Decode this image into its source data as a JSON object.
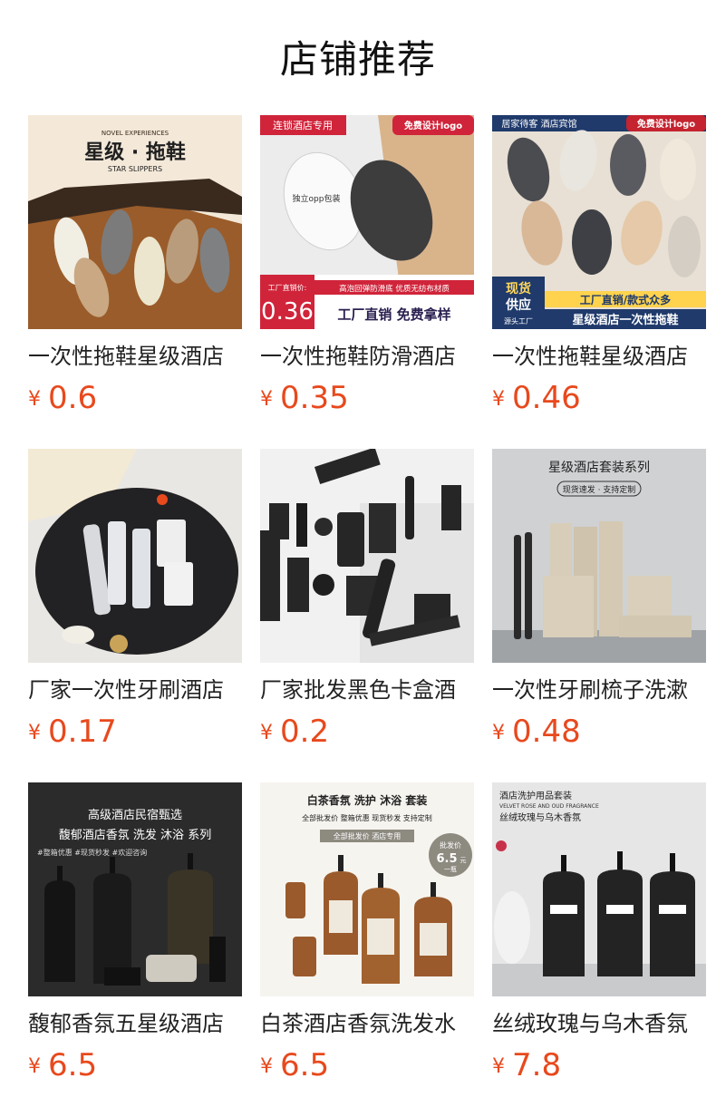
{
  "page": {
    "title": "店铺推荐"
  },
  "currency_symbol": "¥",
  "colors": {
    "price": "#e8491d",
    "badge_red": "#e0283a",
    "text": "#222222"
  },
  "products": [
    {
      "name": "一次性拖鞋星级酒店",
      "price": "0.6",
      "image": {
        "icon": "slippers-image",
        "texts": [
          "NOVEL EXPERIENCES",
          "星级 · 拖鞋",
          "STAR SLIPPERS"
        ]
      }
    },
    {
      "name": "一次性拖鞋防滑酒店",
      "price": "0.35",
      "image": {
        "icon": "slippers-image",
        "texts": [
          "连锁酒店专用",
          "免费设计logo",
          "独立opp包装",
          "工厂直销价:",
          "0.36",
          "高泡回弹防滑底 优质无纺布材质",
          "工厂直销 免费拿样"
        ]
      }
    },
    {
      "name": "一次性拖鞋星级酒店",
      "price": "0.46",
      "image": {
        "icon": "slippers-image",
        "texts": [
          "居家待客 酒店宾馆",
          "免费设计logo",
          "现货",
          "供应",
          "源头工厂",
          "工厂直销/款式众多",
          "星级酒店一次性拖鞋"
        ]
      }
    },
    {
      "name": "厂家一次性牙刷酒店",
      "price": "0.17",
      "image": {
        "icon": "toiletry-kit-image",
        "texts": []
      }
    },
    {
      "name": "厂家批发黑色卡盒酒",
      "price": "0.2",
      "image": {
        "icon": "toiletry-kit-image",
        "texts": []
      }
    },
    {
      "name": "一次性牙刷梳子洗漱",
      "price": "0.48",
      "image": {
        "icon": "toothbrush-box-image",
        "texts": [
          "星级酒店套装系列",
          "现货速发 · 支持定制"
        ]
      }
    },
    {
      "name": "馥郁香氛五星级酒店",
      "price": "6.5",
      "image": {
        "icon": "shampoo-bottles-image",
        "texts": [
          "高级酒店民宿甄选",
          "馥郁酒店香氛 洗发 沐浴 系列",
          "#整箱优惠 #现货秒发 #欢迎咨询"
        ]
      }
    },
    {
      "name": "白茶酒店香氛洗发水",
      "price": "6.5",
      "image": {
        "icon": "shampoo-bottles-image",
        "texts": [
          "白茶香氛 洗护 沐浴 套装",
          "全部批发价 整箱优惠 现货秒发 支持定制",
          "全部批发价 酒店专用",
          "批发价",
          "6.5",
          "元",
          "一瓶"
        ]
      }
    },
    {
      "name": "丝绒玫瑰与乌木香氛",
      "price": "7.8",
      "image": {
        "icon": "shampoo-bottles-image",
        "texts": [
          "酒店洗护用品套装",
          "VELVET ROSE AND OUD FRAGRANCE",
          "丝绒玫瑰与乌木香氛"
        ]
      }
    }
  ]
}
